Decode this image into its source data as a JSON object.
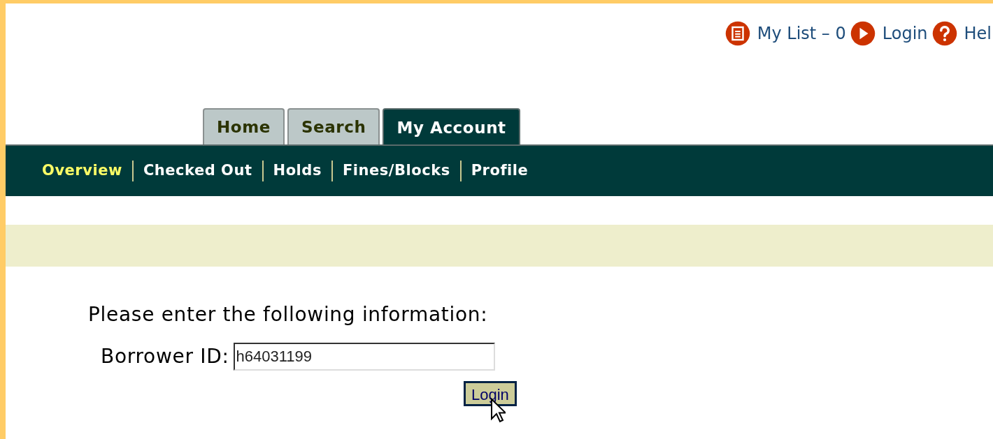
{
  "top_links": [
    {
      "kind": "list",
      "label": "My List – 0"
    },
    {
      "kind": "login",
      "label": "Login"
    },
    {
      "kind": "help",
      "label": "Hel"
    }
  ],
  "tabs": [
    {
      "label": "Home",
      "selected": false
    },
    {
      "label": "Search",
      "selected": false
    },
    {
      "label": "My Account",
      "selected": true
    }
  ],
  "subnav": [
    {
      "label": "Overview",
      "selected": true
    },
    {
      "label": "Checked Out",
      "selected": false
    },
    {
      "label": "Holds",
      "selected": false
    },
    {
      "label": "Fines/Blocks",
      "selected": false
    },
    {
      "label": "Profile",
      "selected": false
    }
  ],
  "form": {
    "heading": "Please enter the following information:",
    "field_label": "Borrower ID:",
    "field_value": "h64031199",
    "button": "Login"
  }
}
